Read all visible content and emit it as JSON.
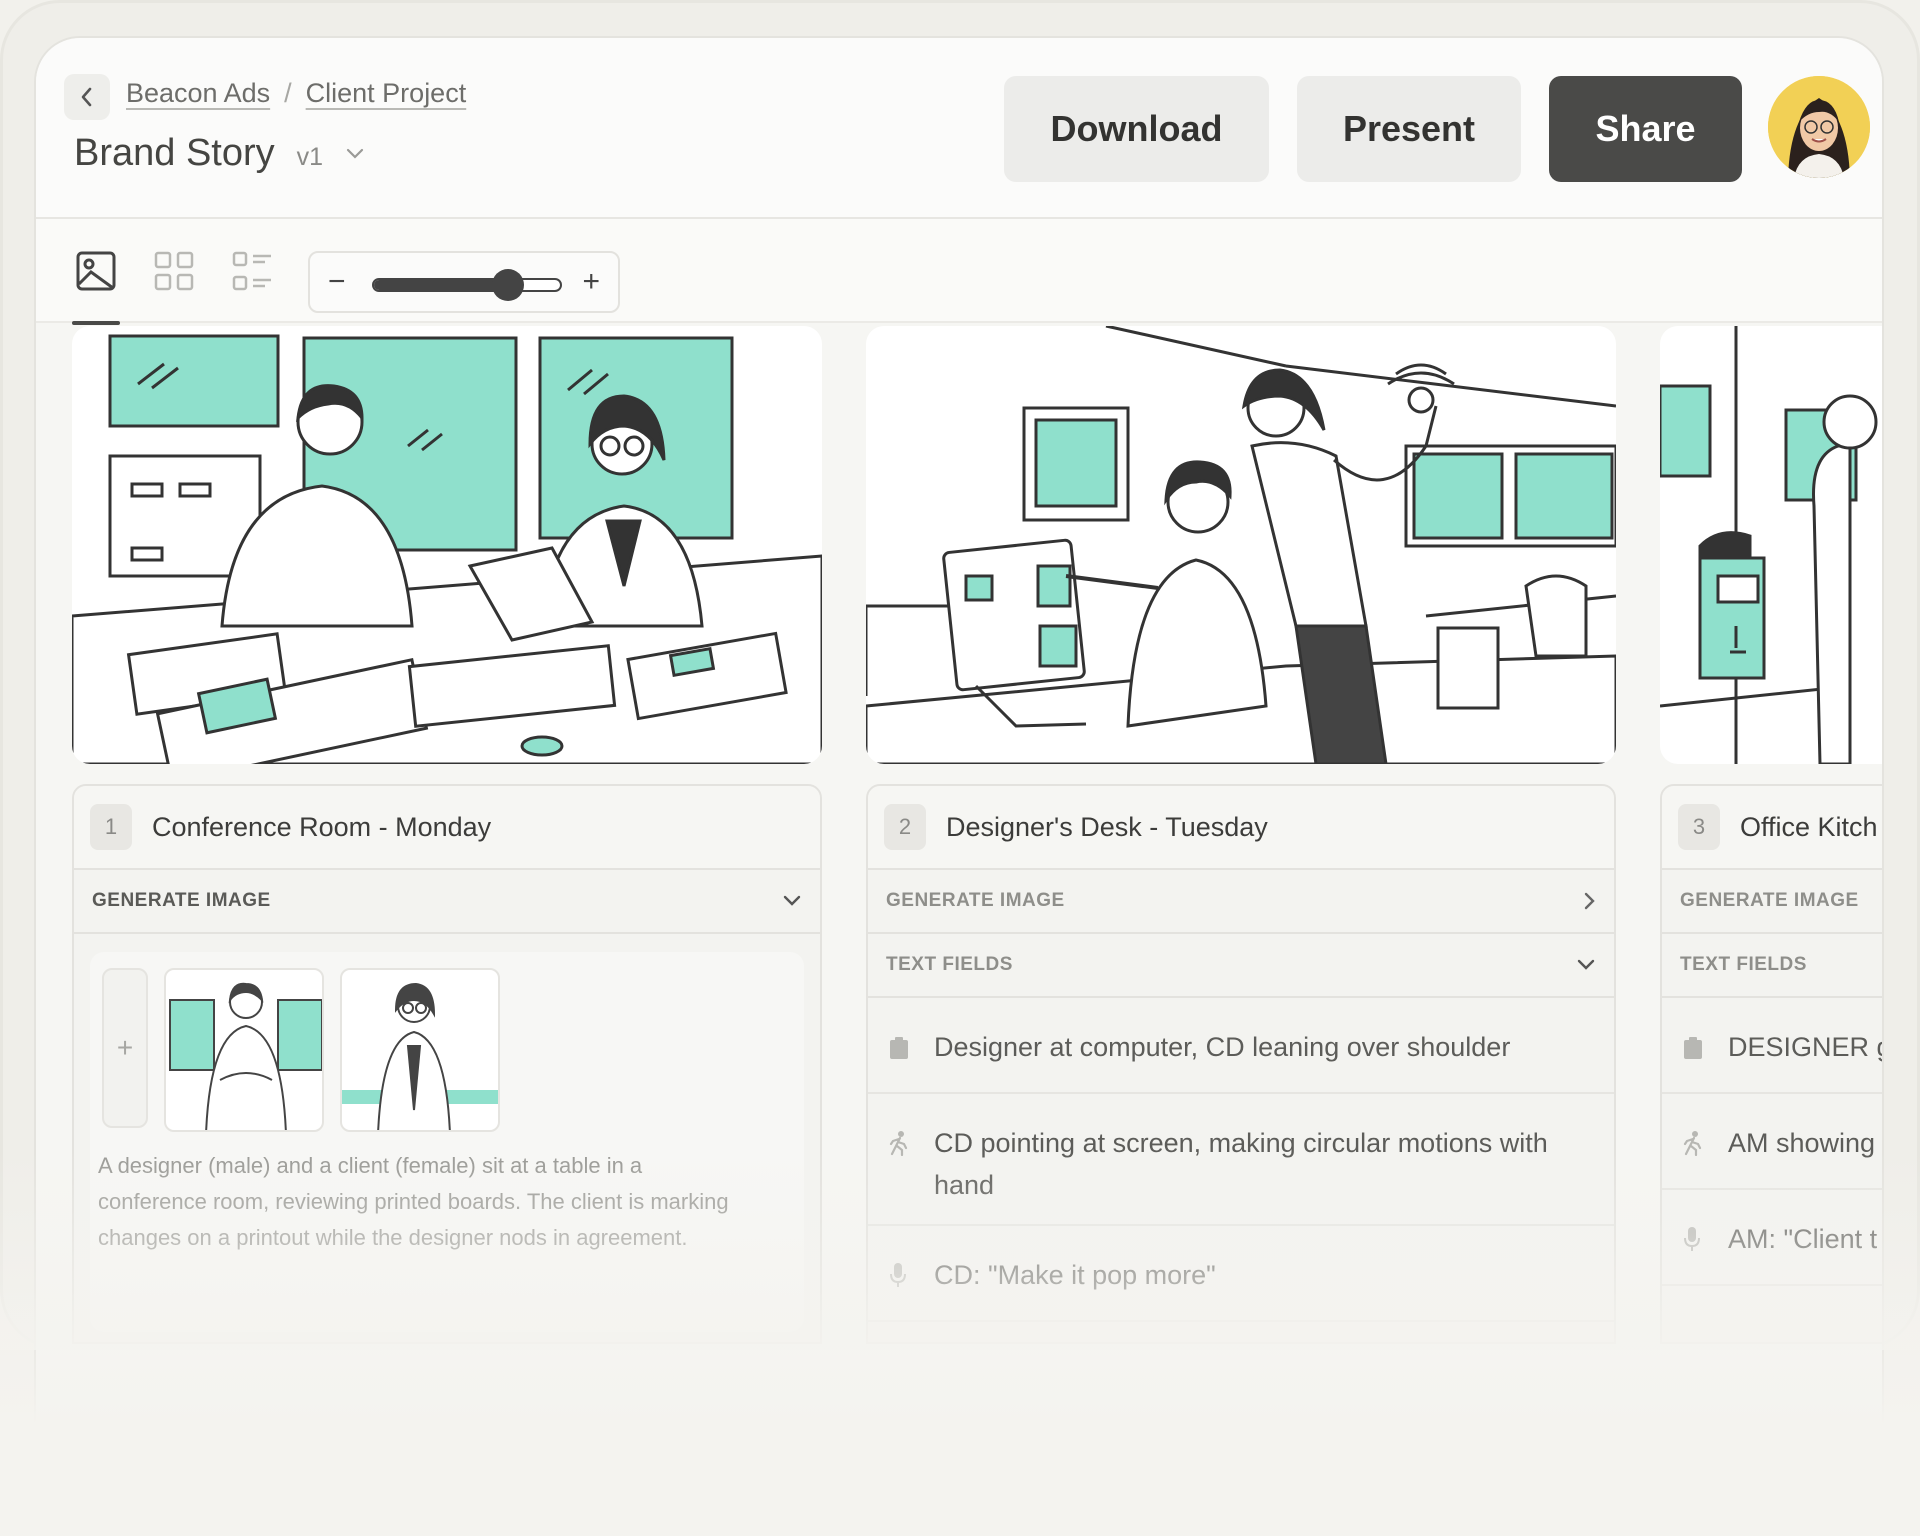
{
  "header": {
    "breadcrumb": [
      "Beacon Ads",
      "Client Project"
    ],
    "breadcrumb_sep": "/",
    "title": "Brand Story",
    "version": "v1",
    "buttons": {
      "download": "Download",
      "present": "Present",
      "share": "Share"
    }
  },
  "toolbar": {
    "zoom_minus": "−",
    "zoom_plus": "+",
    "zoom_level": 0.72
  },
  "scenes": [
    {
      "number": "1",
      "title": "Conference Room - Monday",
      "generate_label": "GENERATE IMAGE",
      "add_label": "+",
      "description": "A designer (male) and a client (female) sit at a table in a conference room, reviewing printed boards. The client is marking changes on a printout while the designer nods in agreement."
    },
    {
      "number": "2",
      "title": "Designer's Desk - Tuesday",
      "generate_label": "GENERATE IMAGE",
      "text_fields_label": "TEXT FIELDS",
      "fields": [
        {
          "icon": "clipboard-icon",
          "text": "Designer at computer, CD leaning over shoulder"
        },
        {
          "icon": "action-icon",
          "text": "CD pointing at screen, making circular motions with hand"
        },
        {
          "icon": "mic-icon",
          "text": "CD: \"Make it pop more\""
        }
      ]
    },
    {
      "number": "3",
      "title": "Office Kitch",
      "generate_label": "GENERATE IMAGE",
      "text_fields_label": "TEXT FIELDS",
      "fields": [
        {
          "icon": "clipboard-icon",
          "text": "DESIGNER gi"
        },
        {
          "icon": "action-icon",
          "text": "AM showing"
        },
        {
          "icon": "mic-icon",
          "text": "AM: \"Client t"
        }
      ]
    }
  ],
  "colors": {
    "accent_mint": "#8fe0cc",
    "share_button": "#4a4a48",
    "avatar_bg": "#f2d055"
  }
}
